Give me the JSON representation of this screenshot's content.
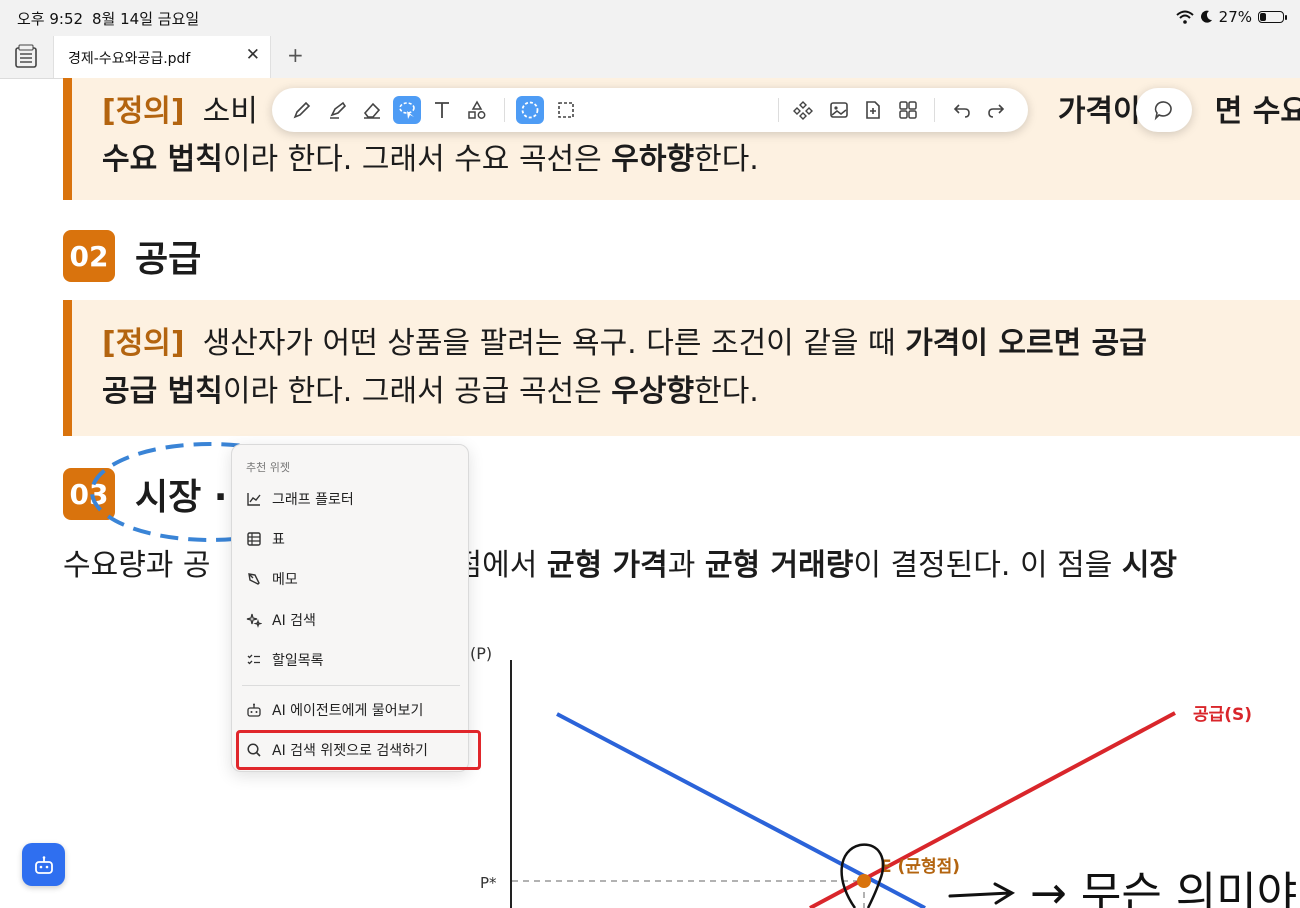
{
  "status_bar": {
    "time": "오후 9:52",
    "date": "8월 14일 금요일",
    "battery": "27%",
    "battery_level": 0.27
  },
  "tabs": {
    "active_title": "경제-수요와공급.pdf",
    "close_icon": "close-icon",
    "new_tab": "+"
  },
  "document": {
    "demand_callout": {
      "tag": "[정의]",
      "line1_a": "소비",
      "line1_b": "가격이 오",
      "line1_c": "면 수요",
      "line2_bold1": "수요 법칙",
      "line2_text1": "이라 한다. 그래서 수요 곡선은 ",
      "line2_bold2": "우하향",
      "line2_text2": "한다."
    },
    "section2": {
      "number": "02",
      "title": "공급"
    },
    "supply_callout": {
      "tag": "[정의]",
      "line1_text": "생산자가 어떤 상품을 팔려는 욕구. 다른 조건이 같을 때 ",
      "line1_bold": "가격이 오르면 공급",
      "line2_bold1": "공급 법칙",
      "line2_text1": "이라 한다. 그래서 공급 곡선은 ",
      "line2_bold2": "우상향",
      "line2_text2": "한다."
    },
    "section3": {
      "number": "03",
      "title": "시장 ·"
    },
    "market_para": {
      "text1": "수요량과 공",
      "text2": "점에서 ",
      "bold1": "균형 가격",
      "text3": "과 ",
      "bold2": "균형 거래량",
      "text4": "이 결정된다. 이 점을 ",
      "bold3": "시장"
    }
  },
  "toolbar": {
    "tools": [
      "pen-icon",
      "highlighter-icon",
      "eraser-icon",
      "lasso-select-icon",
      "text-icon",
      "shapes-icon",
      "lasso-circle-icon",
      "rect-select-icon",
      "widget-icon",
      "image-icon",
      "add-page-icon",
      "grid-icon",
      "undo-icon",
      "redo-icon"
    ],
    "chat_icon": "chat-bubble-icon"
  },
  "menu": {
    "header": "추천 위젯",
    "items": [
      {
        "label": "그래프 플로터",
        "icon": "chart-line-icon"
      },
      {
        "label": "표",
        "icon": "table-icon"
      },
      {
        "label": "메모",
        "icon": "pen-nib-icon"
      },
      {
        "label": "AI 검색",
        "icon": "sparkle-icon"
      },
      {
        "label": "할일목록",
        "icon": "checklist-icon"
      },
      {
        "label": "AI 에이전트에게 물어보기",
        "icon": "robot-icon"
      },
      {
        "label": "AI 검색 위젯으로 검색하기",
        "icon": "search-icon"
      }
    ]
  },
  "chart_data": {
    "type": "line",
    "ylabel": "(P)",
    "y_tick": "P*",
    "series": [
      {
        "name": "공급(S)",
        "color": "#d9262b",
        "direction": "upward"
      },
      {
        "name": "",
        "color": "#2b63d9",
        "direction": "downward"
      }
    ],
    "equilibrium_label": "E (균형점)",
    "equilibrium_color": "#d9730d"
  },
  "handwriting": {
    "arrow_text": "→ 무슨 의미야"
  },
  "colors": {
    "accent_orange": "#d9730d",
    "callout_bg": "#fdf1e1",
    "tag_color": "#b3640f",
    "active_tool": "#4e9cf5",
    "highlight_red": "#e0262b",
    "assistant_blue": "#2f6ff0"
  }
}
